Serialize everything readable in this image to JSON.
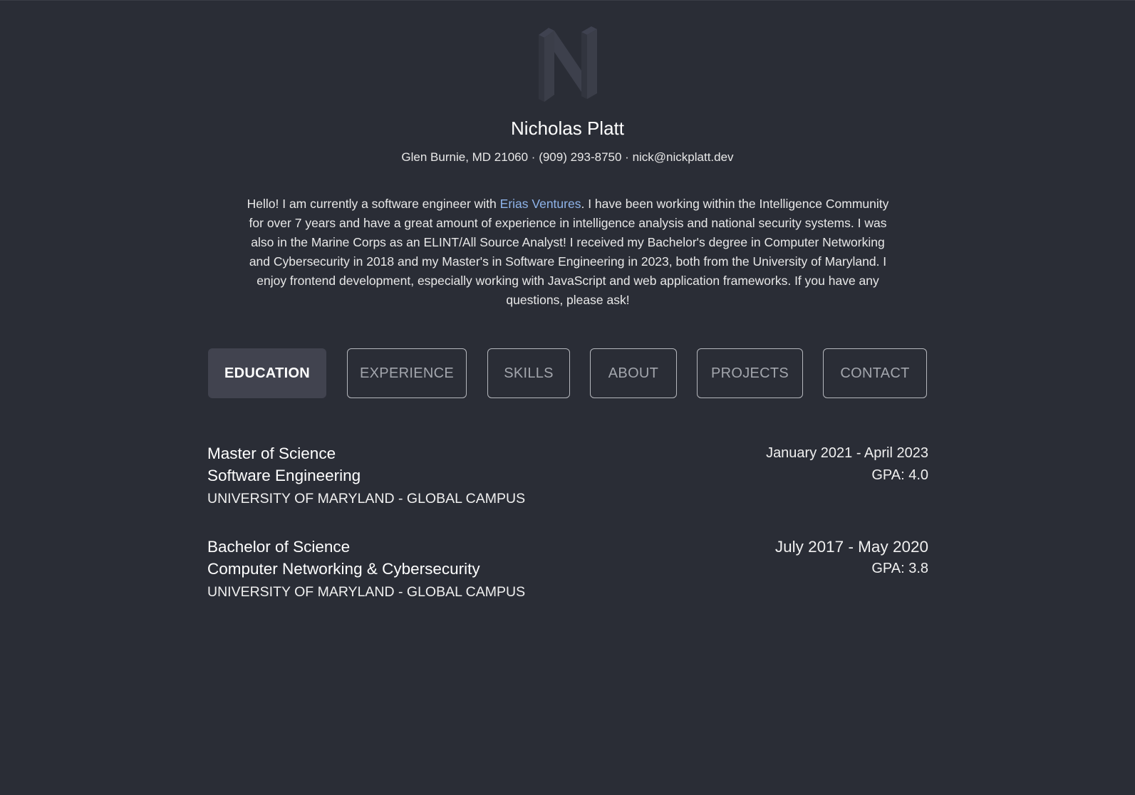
{
  "logo": {
    "icon": "n-logo-icon",
    "color": "#3b3e49"
  },
  "header": {
    "name": "Nicholas Platt",
    "location": "Glen Burnie, MD 21060",
    "phone": "(909) 293-8750",
    "email": "nick@nickplatt.dev",
    "separator": " · "
  },
  "bio": {
    "before_link": "Hello! I am currently a software engineer with ",
    "link_text": "Erias Ventures",
    "after_link": ". I have been working within the Intelligence Community for over 7 years and have a great amount of experience in intelligence analysis and national security systems. I was also in the Marine Corps as an ELINT/All Source Analyst! I received my Bachelor's degree in Computer Networking and Cybersecurity in 2018 and my Master's in Software Engineering in 2023, both from the University of Maryland. I enjoy frontend development, especially working with JavaScript and web application frameworks. If you have any questions, please ask!",
    "link_color": "#8fb4ea"
  },
  "tabs": [
    {
      "label": "EDUCATION",
      "active": true
    },
    {
      "label": "EXPERIENCE",
      "active": false
    },
    {
      "label": "SKILLS",
      "active": false
    },
    {
      "label": "ABOUT",
      "active": false
    },
    {
      "label": "PROJECTS",
      "active": false
    },
    {
      "label": "CONTACT",
      "active": false
    }
  ],
  "education": [
    {
      "degree": "Master of Science",
      "field": "Software Engineering",
      "school": "UNIVERSITY OF MARYLAND - GLOBAL CAMPUS",
      "dates": "January 2021 - April 2023",
      "gpa": "GPA: 4.0"
    },
    {
      "degree": "Bachelor of Science",
      "field": "Computer Networking & Cybersecurity",
      "school": "UNIVERSITY OF MARYLAND - GLOBAL CAMPUS",
      "dates": "July 2017 - May 2020",
      "gpa": "GPA: 3.8"
    }
  ],
  "colors": {
    "background": "#2a2d36",
    "active_tab": "#41434f",
    "tab_border": "#b5b7bd",
    "tab_text": "#a3a6ad"
  }
}
